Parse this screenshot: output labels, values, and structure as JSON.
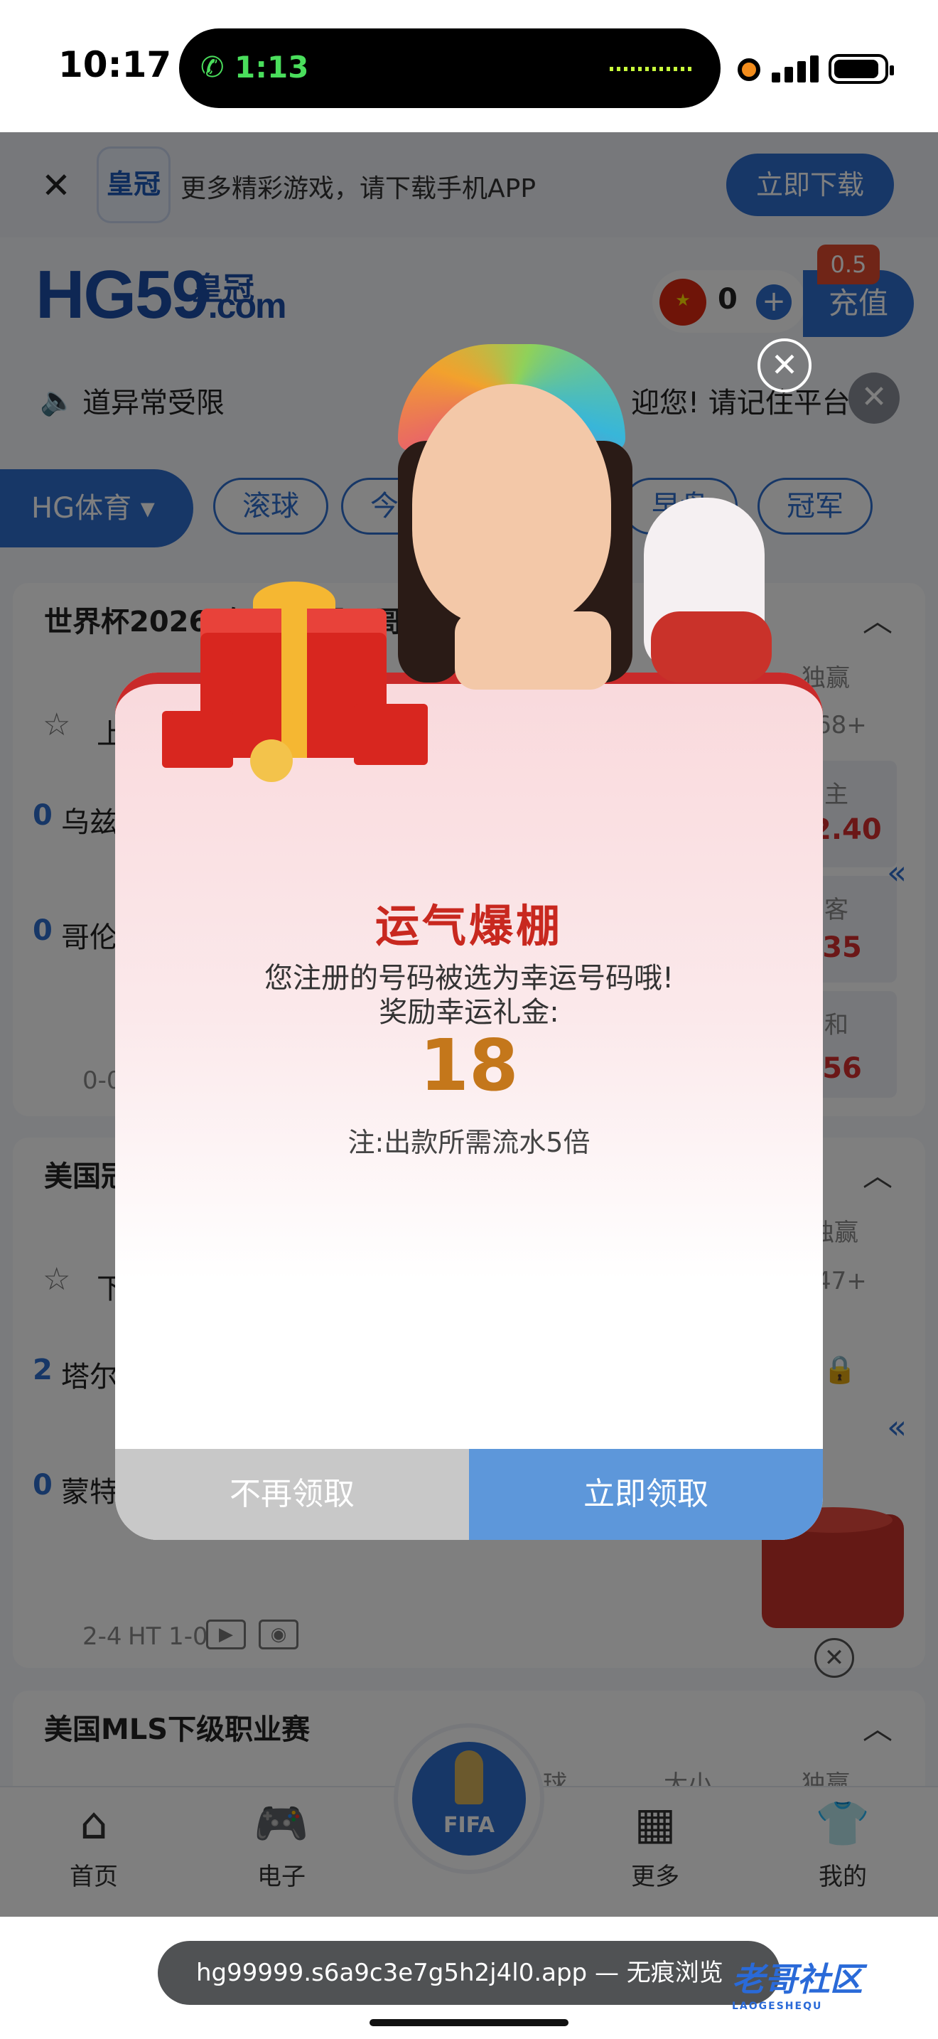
{
  "status_bar": {
    "time": "10:17",
    "call_time": "1:13"
  },
  "banner": {
    "text": "更多精彩游戏，请下载手机APP",
    "download_label": "立即下载",
    "logo_label": "皇冠"
  },
  "header": {
    "brand_main": "HG59",
    "brand_suffix": ".com",
    "brand_cn": "皇冠",
    "balance": "0",
    "recharge_label": "充值",
    "recharge_badge": "0.5"
  },
  "notice": {
    "left": "道异常受限",
    "right": "迎您! 请记住平台"
  },
  "sport_tabs": {
    "active": "HG体育",
    "chips": [
      "滚球",
      "今日",
      "早盘",
      "冠军"
    ]
  },
  "leagues": [
    {
      "title": "世界杯2026(在美国-墨西哥-加拿大)",
      "col_header": "独赢",
      "more": "68+",
      "fav": "上",
      "teams": [
        {
          "score": "0",
          "name": "乌兹"
        },
        {
          "score": "0",
          "name": "哥伦"
        }
      ],
      "odds": [
        {
          "label": "主",
          "value": "2.40"
        },
        {
          "label": "客",
          "value": ".35"
        },
        {
          "label": "和",
          "value": ".56"
        }
      ],
      "footer": "0-0"
    },
    {
      "title": "美国冠",
      "col_header": "独赢",
      "more": "47+",
      "fav": "下",
      "teams": [
        {
          "score": "2",
          "name": "塔尔"
        },
        {
          "score": "0",
          "name": "蒙特"
        }
      ],
      "footer": "2-4",
      "footer_ht": "HT 1-0"
    },
    {
      "title": "美国MLS下级职业赛",
      "cols": [
        "让球",
        "大小",
        "独赢"
      ]
    }
  ],
  "bottom_nav": [
    {
      "label": "首页",
      "icon": "home-icon"
    },
    {
      "label": "电子",
      "icon": "gamepad-icon"
    },
    {
      "label": "FIFA",
      "icon": "fifa-cup-icon"
    },
    {
      "label": "更多",
      "icon": "grid-icon"
    },
    {
      "label": "我的",
      "icon": "shirt-icon"
    }
  ],
  "browser": {
    "url": "hg99999.s6a9c3e7g5h2j4l0.app — 无痕浏览",
    "watermark": "老哥社区",
    "watermark_sub": "LAOGESHEQU"
  },
  "modal": {
    "title": "运气爆棚",
    "message_line1": "您注册的号码被选为幸运号码哦!",
    "message_line2": "奖励幸运礼金:",
    "amount": "18",
    "note": "注:出款所需流水5倍",
    "decline_label": "不再领取",
    "accept_label": "立即领取"
  },
  "colors": {
    "brand_blue": "#2f6fcf",
    "title_red": "#c8281f",
    "amount_orange": "#c4771b",
    "accept_blue": "#5d97da",
    "decline_gray": "#c8c8c8"
  }
}
